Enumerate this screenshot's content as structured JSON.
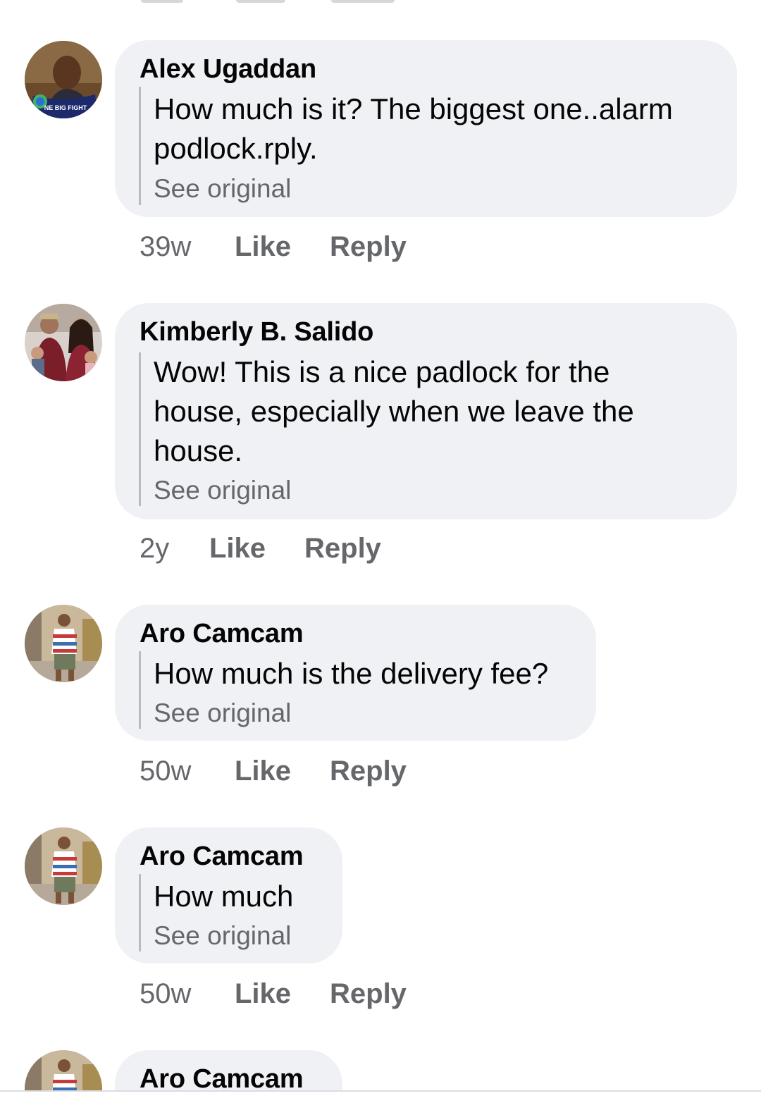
{
  "comments": [
    {
      "author": "Alex Ugaddan",
      "text": "How much is it? The biggest one..alarm\npodlock.rply.",
      "see_original": "See original",
      "time": "39w",
      "like": "Like",
      "reply": "Reply",
      "avatar_badge": "NE BIG FIGHT"
    },
    {
      "author": "Kimberly B. Salido",
      "text": "Wow! This is a nice padlock for the\nhouse, especially when we leave the\nhouse.",
      "see_original": "See original",
      "time": "2y",
      "like": "Like",
      "reply": "Reply"
    },
    {
      "author": "Aro Camcam",
      "text": "How much is the delivery fee?",
      "see_original": "See original",
      "time": "50w",
      "like": "Like",
      "reply": "Reply"
    },
    {
      "author": "Aro Camcam",
      "text": "How much",
      "see_original": "See original",
      "time": "50w",
      "like": "Like",
      "reply": "Reply"
    },
    {
      "author": "Aro Camcam"
    }
  ],
  "colors": {
    "bubble": "#f0f1f5",
    "text": "#050505",
    "secondary": "#65676b",
    "quote_bar": "#b9bbc0"
  }
}
